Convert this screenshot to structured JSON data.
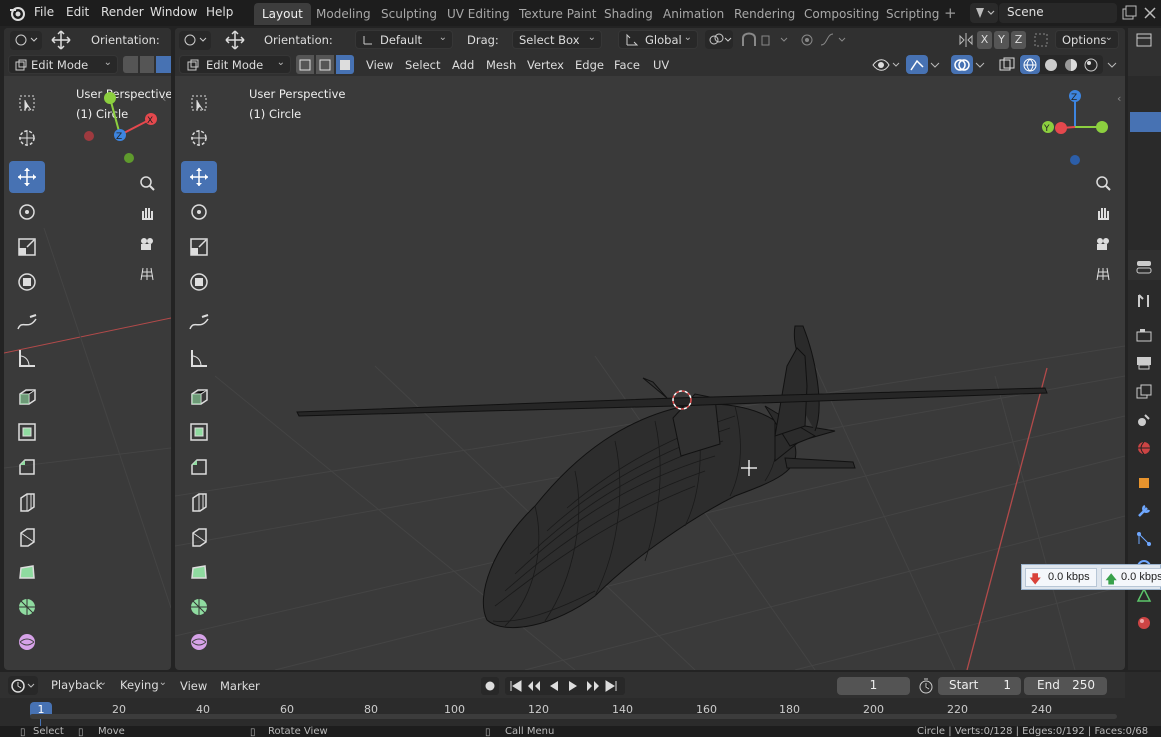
{
  "topbar": {
    "menus": [
      "File",
      "Edit",
      "Render",
      "Window",
      "Help"
    ],
    "workspaces": [
      "Layout",
      "Modeling",
      "Sculpting",
      "UV Editing",
      "Texture Paint",
      "Shading",
      "Animation",
      "Rendering",
      "Compositing",
      "Scripting"
    ],
    "active_workspace": "Layout",
    "scene_name": "Scene"
  },
  "left_view": {
    "orientation_label": "Orientation:",
    "mode": "Edit Mode",
    "overlay_title": "User Perspective",
    "overlay_object": "(1) Circle"
  },
  "main_view": {
    "orientation_label": "Orientation:",
    "orientation_value": "Default",
    "drag_label": "Drag:",
    "drag_value": "Select Box",
    "transform_space": "Global",
    "axes": [
      "X",
      "Y",
      "Z"
    ],
    "options_label": "Options",
    "mode": "Edit Mode",
    "menus": [
      "View",
      "Select",
      "Add",
      "Mesh",
      "Vertex",
      "Edge",
      "Face",
      "UV"
    ],
    "overlay_title": "User Perspective",
    "overlay_object": "(1) Circle"
  },
  "network_widget": {
    "download": "0.0 kbps",
    "upload": "0.0 kbps"
  },
  "timeline": {
    "menus": [
      "Playback",
      "Keying",
      "View",
      "Marker"
    ],
    "current_frame": "1",
    "start_label": "Start",
    "start_value": "1",
    "end_label": "End",
    "end_value": "250",
    "ruler_ticks": [
      "1",
      "20",
      "40",
      "60",
      "80",
      "100",
      "120",
      "140",
      "160",
      "180",
      "200",
      "220",
      "240"
    ]
  },
  "statusbar": {
    "select": "Select",
    "move": "Move",
    "rotate": "Rotate View",
    "call_menu": "Call Menu",
    "stats": "Circle | Verts:0/128 | Edges:0/192 | Faces:0/68"
  },
  "colors": {
    "accent": "#4772b3",
    "axis_x": "#e5484d",
    "axis_y": "#8ccf3f",
    "axis_z": "#3d85e0",
    "background": "#3a3a3a"
  }
}
